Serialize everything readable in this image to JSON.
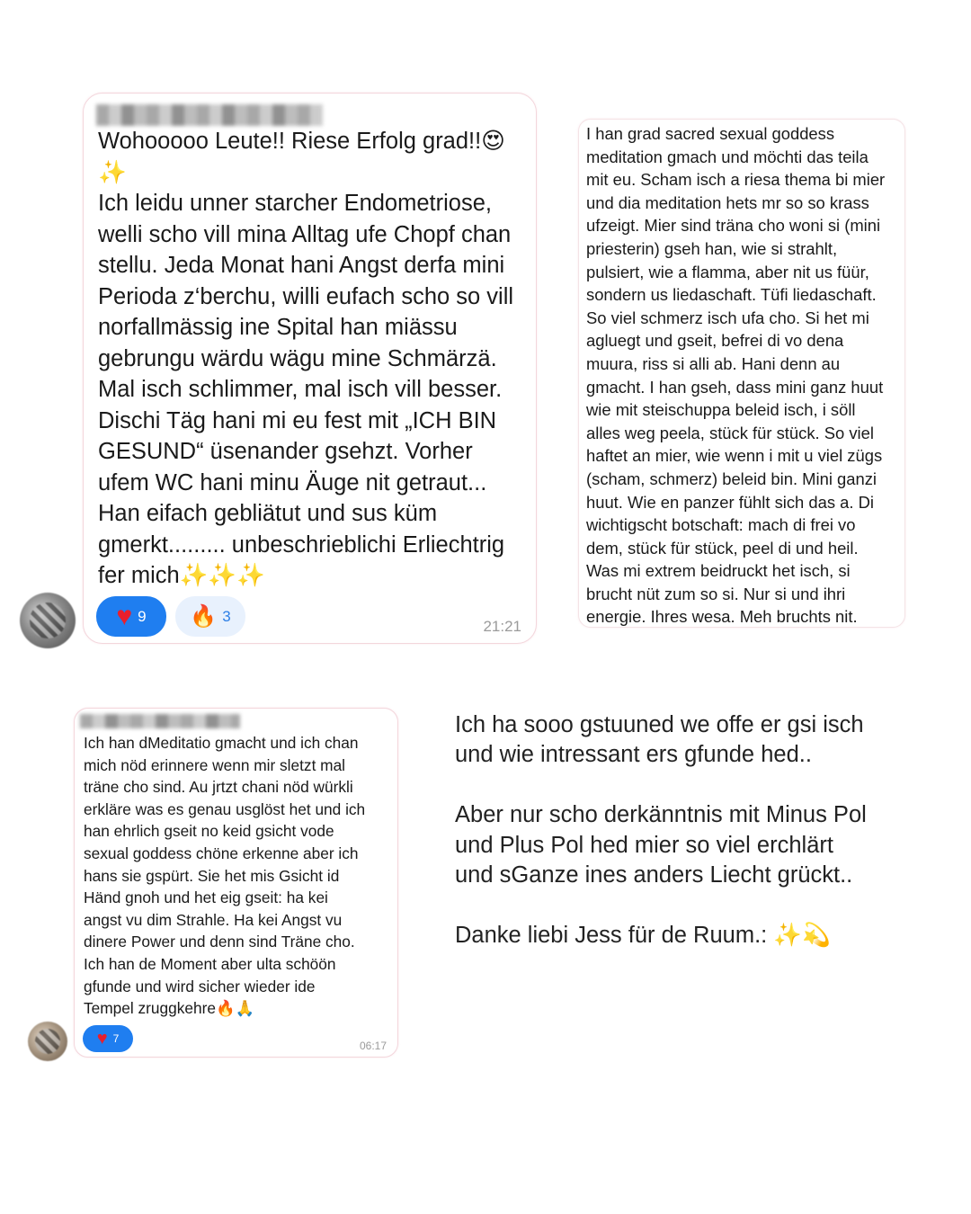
{
  "messages": [
    {
      "text": "Wohooooo Leute!! Riese Erfolg grad!!😍\n✨\nIch leidu unner starcher Endometriose,\nwelli scho vill mina Alltag ufe Chopf chan\nstellu. Jeda Monat hani Angst derfa mini\nPerioda z‘berchu, willi eufach scho so vill\nnorfallmässig ine Spital han miässu\ngebrungu wärdu wägu mine Schmärzä.\nMal isch schlimmer, mal isch vill besser.\nDischi Täg hani mi eu fest mit „ICH BIN\nGESUND“ üsenander gsehzt. Vorher\nufem WC hani minu Äuge nit getraut...\nHan eifach gebliätut und sus küm\ngmerkt......... unbeschrieblichi Erliechtrig\nfer mich✨✨✨",
      "reactions": [
        {
          "icon": "heart",
          "glyph": "♥",
          "count": "9"
        },
        {
          "icon": "fire",
          "glyph": "🔥",
          "count": "3"
        }
      ],
      "time": "21:21"
    },
    {
      "text": "I han grad sacred sexual goddess\nmeditation gmach und möchti das teila\nmit eu. Scham isch a riesa thema bi mier\nund dia meditation hets mr so so krass\nufzeigt. Mier sind träna cho woni si (mini\npriesterin) gseh han, wie si strahlt,\npulsiert, wie a flamma, aber nit us füür,\nsondern us liedaschaft. Tüfi liedaschaft.\nSo viel schmerz isch ufa cho. Si het mi\nagluegt und gseit, befrei di vo dena\nmuura, riss si alli ab. Hani denn au\ngmacht. I han gseh, dass mini ganz huut\nwie mit steischuppa beleid isch, i söll\nalles weg peela, stück für stück. So viel\nhaftet an mier, wie wenn i mit u viel zügs\n(scham, schmerz) beleid bin. Mini ganzi\nhuut. Wie en panzer fühlt sich das a. Di\nwichtigscht botschaft: mach di frei vo\ndem, stück für stück, peel di und heil.\nWas mi extrem beidruckt het isch, si\nbrucht nüt zum so si. Nur si und ihri\nenergie. Ihres wesa. Meh bruchts nit."
    },
    {
      "text": "Ich han dMeditatio gmacht und ich chan\nmich nöd erinnere wenn mir sletzt mal\nträne cho sind. Au jrtzt chani nöd würkli\nerkläre was es genau usglöst het und ich\nhan ehrlich gseit no keid gsicht vode\nsexual goddess chöne erkenne aber ich\nhans sie gspürt. Sie het mis Gsicht id\nHänd gnoh und het eig gseit: ha kei\nangst vu dim Strahle. Ha kei Angst vu\ndinere Power und denn sind Träne cho.\nIch han de Moment aber ulta schöön\ngfunde und wird sicher wieder ide\nTempel zruggkehre🔥🙏",
      "reactions": [
        {
          "icon": "heart",
          "glyph": "♥",
          "count": "7"
        }
      ],
      "time": "06:17"
    },
    {
      "text": "Ich ha sooo gstuuned we offe er gsi isch\nund wie intressant ers gfunde hed..\n\nAber nur scho derkänntnis mit Minus Pol\nund Plus Pol hed mier so viel erchlärt\nund sGanze ines anders Liecht grückt..\n\nDanke liebi Jess für de Ruum.: ✨💫"
    }
  ],
  "colors": {
    "reaction_blue": "#1f7ef0",
    "reaction_light": "#e8f1fd",
    "bubble_border": "#f3d6dc",
    "timestamp": "#9b9b9b"
  }
}
